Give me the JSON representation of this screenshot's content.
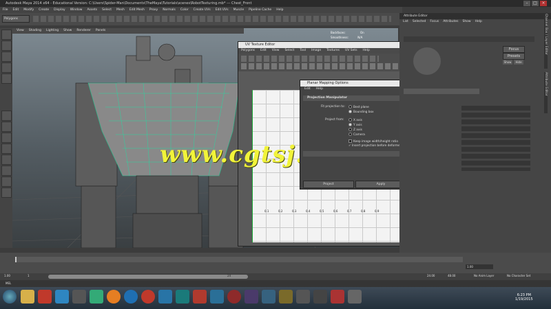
{
  "window": {
    "title": "Autodesk Maya 2014 x64 - Educational Version: C:\\Users\\Spider-Man\\Documents\\TheMaya\\Tutorials\\scenes\\RobotTexturing.mb*  ---  Chest_Front"
  },
  "main_menu": [
    "File",
    "Edit",
    "Modify",
    "Create",
    "Display",
    "Window",
    "Assets",
    "Select",
    "Mesh",
    "Edit Mesh",
    "Proxy",
    "Normals",
    "Color",
    "Create UVs",
    "Edit UVs",
    "Muscle",
    "Pipeline Cache",
    "Help"
  ],
  "mode_selector": "Polygons",
  "viewport": {
    "menu": [
      "View",
      "Shading",
      "Lighting",
      "Show",
      "Renderer",
      "Panels"
    ],
    "hud": [
      "Backfaces:",
      "Smoothness:"
    ],
    "hud_values": [
      "On",
      "N/A"
    ]
  },
  "watermark": "www.cgtsj.com",
  "uv_editor": {
    "title": "UV Texture Editor",
    "menu": [
      "Polygons",
      "Edit",
      "View",
      "Select",
      "Tool",
      "Image",
      "Textures",
      "UV Sets",
      "Help"
    ],
    "field_values": [
      "0.550",
      "0.250"
    ],
    "axis_labels": [
      "0.1",
      "0.2",
      "0.3",
      "0.4",
      "0.5",
      "0.6",
      "0.7",
      "0.8",
      "0.9"
    ]
  },
  "planar_dialog": {
    "title": "Planar Mapping Options",
    "menu": [
      "Edit",
      "Help"
    ],
    "section": "Projection Manipulator",
    "fit_label": "Fit projection to:",
    "fit_options": [
      "Best plane",
      "Bounding box"
    ],
    "project_label": "Project from:",
    "project_options": [
      "X axis",
      "Y axis",
      "Z axis",
      "Camera"
    ],
    "keep_ratio": "Keep image width/height ratio",
    "insert_before": "Insert projection before deformers",
    "buttons": [
      "Project",
      "Apply",
      "Close"
    ]
  },
  "attribute_editor": {
    "title": "Attribute Editor",
    "menu": [
      "List",
      "Selected",
      "Focus",
      "Attributes",
      "Show",
      "Help"
    ],
    "buttons": [
      "Focus",
      "Presets",
      "Show",
      "Hide"
    ],
    "bottom_buttons": [
      "Select",
      "Load Attributes",
      "Copy Tab"
    ],
    "side_tabs": [
      "Channel Box / Layer Editor",
      "Attribute Editor"
    ]
  },
  "timeline": {
    "start": "1.00",
    "current": "1.00",
    "range_start": "1",
    "range_end": "24",
    "end_a": "24.00",
    "end_b": "48.00",
    "anim_layer": "No Anim Layer",
    "char_set": "No Character Set",
    "cmd_label": "MEL"
  },
  "taskbar": {
    "time": "6:23 PM",
    "date": "1/19/2015"
  }
}
